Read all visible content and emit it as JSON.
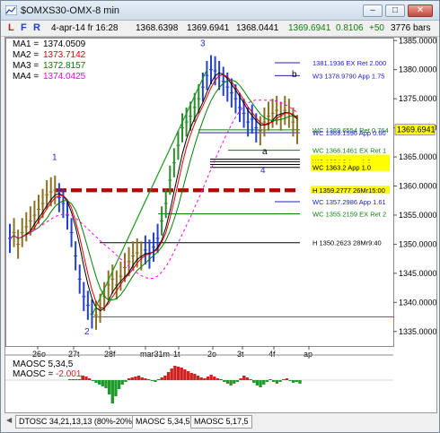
{
  "window": {
    "title": "$OMXS30-OMX-8 min",
    "buttons": {
      "minimize": "–",
      "maximize": "□",
      "close": "✕"
    }
  },
  "toolbar": {
    "letters": [
      {
        "label": "L",
        "color": "#c02020"
      },
      {
        "label": "F",
        "color": "#2040c0"
      },
      {
        "label": "R",
        "color": "#2040c0"
      }
    ],
    "datetime": "4-apr-14 fr 16:28",
    "open": "1368.6398",
    "high": "1369.6941",
    "low": "1368.0441",
    "close": "1369.6941",
    "change": "0.8106",
    "change_ticks": "+50",
    "bars": "3776 bars"
  },
  "chart_data": {
    "type": "line",
    "instrument": "$OMXS30-OMX-8 min",
    "y_axis_ticks": [
      "1385.0000",
      "1380.0000",
      "1375.0000",
      "1370.0000",
      "1365.0000",
      "1360.0000",
      "1355.0000",
      "1350.0000",
      "1345.0000",
      "1340.0000",
      "1335.0000"
    ],
    "ylim": [
      1332.5,
      1385.5
    ],
    "x_axis_ticks": [
      "26o",
      "27t",
      "28f",
      "mar31m",
      "1t",
      "2o",
      "3t",
      "4f",
      "ap"
    ],
    "moving_averages": [
      {
        "name": "MA1",
        "value": "1374.0509",
        "color": "#000000"
      },
      {
        "name": "MA2",
        "value": "1373.7142",
        "color": "#e00000"
      },
      {
        "name": "MA3",
        "value": "1372.8157",
        "color": "#008000"
      },
      {
        "name": "MA4",
        "value": "1374.0425",
        "color": "#ff00ff"
      }
    ],
    "wave_labels": [
      {
        "label": "1",
        "color": "#2030c0"
      },
      {
        "label": "2",
        "color": "#2030c0"
      },
      {
        "label": "3",
        "color": "#2030c0"
      },
      {
        "label": "4",
        "color": "#2030c0"
      },
      {
        "label": "a",
        "color": "#000000"
      },
      {
        "label": "b",
        "color": "#000000"
      }
    ],
    "levels": [
      {
        "label": "1381.1936 EX Ret 2.000",
        "value": 1381.1936,
        "color": "#2020c0"
      },
      {
        "label": "W3 1378.9790 App 1.75",
        "value": 1378.979,
        "color": "#2020c0"
      },
      {
        "label": "WC 1369.6554 Ret 0.764",
        "value": 1369.6554,
        "color": "#108010"
      },
      {
        "label": "WC 1369.1596 App 0.60",
        "value": 1369.1596,
        "color": "#2020c0"
      },
      {
        "label": "WC 1366.1461 EX Ret 1",
        "value": 1366.1461,
        "color": "#108010"
      },
      {
        "label": "WC 1364.6232 App 1.00",
        "value": 1364.6232,
        "color": "#000000"
      },
      {
        "label": "WC 1364.2 App 1.0",
        "value": 1364.2,
        "color": "#000000"
      },
      {
        "label": "WC 1363.7 App 1.0",
        "value": 1363.7,
        "color": "#000000"
      },
      {
        "label": "WC 1363.2 App 1.0",
        "value": 1363.2,
        "color": "#000000"
      },
      {
        "label": "H 1359.2777 26Mr15:00",
        "value": 1359.2777,
        "color": "#000000"
      },
      {
        "label": "WC 1357.2986 App 1.61",
        "value": 1357.2986,
        "color": "#2020c0"
      },
      {
        "label": "WC 1355.2159 EX Ret 2",
        "value": 1355.2159,
        "color": "#108010"
      },
      {
        "label": "H 1350.2623 28Mr9:40",
        "value": 1350.2623,
        "color": "#000000"
      }
    ],
    "price_tag": "1369.6941",
    "price_series": [
      1351,
      1352,
      1350,
      1352,
      1353,
      1354,
      1355,
      1356,
      1357,
      1358.5,
      1359,
      1359.3,
      1358,
      1357,
      1355,
      1352,
      1348,
      1344,
      1341,
      1339.5,
      1338,
      1337.8,
      1339,
      1341,
      1343,
      1344,
      1343,
      1344.5,
      1346,
      1347,
      1348,
      1348.5,
      1348,
      1349,
      1348.3,
      1349.5,
      1351,
      1354,
      1357,
      1361,
      1364,
      1367,
      1370,
      1371,
      1372,
      1373.5,
      1375,
      1377,
      1379,
      1380,
      1379.8,
      1379,
      1378,
      1377,
      1376,
      1375,
      1373.5,
      1372.5,
      1371,
      1371.5,
      1370,
      1369.5,
      1371,
      1372,
      1372.5,
      1373,
      1372,
      1373,
      1372.5,
      1371,
      1369.6941
    ],
    "indicator": {
      "name": "MAOSC 5,34,5",
      "value_label": "MAOSC",
      "value": "-2.001",
      "histogram": [
        0.3,
        0.5,
        0.7,
        0.6,
        0.5,
        0.4,
        0.2,
        -0.1,
        -0.3,
        -0.5,
        -0.7,
        -0.9,
        -1.6,
        -2.6,
        -1.8,
        -1.0,
        -0.5,
        -0.2,
        0.2,
        0.3,
        0.4,
        0.5,
        0.3,
        0.2,
        0.1,
        -0.1,
        -0.2,
        0.1,
        0.3,
        0.5,
        0.9,
        1.3,
        1.6,
        1.5,
        1.4,
        1.2,
        1.0,
        0.8,
        0.7,
        0.5,
        0.3,
        0.2,
        0.4,
        0.6,
        0.4,
        0.2,
        0.1,
        -0.2,
        -0.4,
        -0.6,
        -0.4,
        -0.2,
        0.2,
        0.5,
        0.3,
        0.1,
        -0.3,
        -0.6,
        -0.8,
        -0.5,
        -0.2,
        0.1,
        -0.2,
        -0.4,
        -0.2,
        0.1,
        0.2,
        -0.1,
        -0.3,
        -0.2,
        -0.4
      ],
      "colors": {
        "positive": "#d02020",
        "negative": "#1f9a2a"
      }
    }
  },
  "tabs": [
    {
      "label": "DTOSC 34,21,13,13 (80%-20%)",
      "active": false
    },
    {
      "label": "MAOSC 5,34,5",
      "active": true
    },
    {
      "label": "MAOSC 5,17,5",
      "active": false
    }
  ]
}
